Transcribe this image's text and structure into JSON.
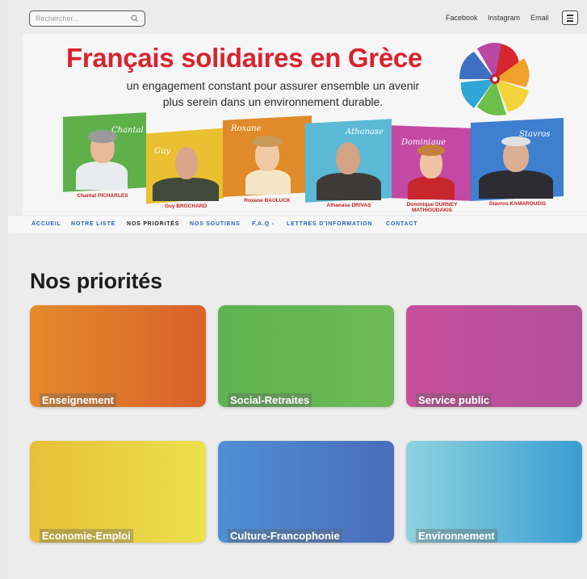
{
  "topbar": {
    "search_placeholder": "Rechercher...",
    "links": [
      "Facebook",
      "Instagram",
      "Email"
    ]
  },
  "banner": {
    "title": "Français solidaires en Grèce",
    "subtitle_line1": "un engagement constant pour assurer ensemble un avenir",
    "subtitle_line2": "plus serein dans un environnement durable.",
    "candidates": [
      {
        "signature": "Chantal",
        "caption": "Chantal PICHARLES",
        "color": "#5db04a"
      },
      {
        "signature": "Guy",
        "caption": "Guy BROCHARD",
        "color": "#e9c02f"
      },
      {
        "signature": "Roxane",
        "caption": "Roxane BAULUCK",
        "color": "#e08a2a"
      },
      {
        "signature": "Athanase",
        "caption": "Athanase DRIVAS",
        "color": "#5bb9d6"
      },
      {
        "signature": "Dominique",
        "caption_line1": "Dominique DURNEY",
        "caption_line2": "MATHIOUDAKIS",
        "color": "#c34aa4"
      },
      {
        "signature": "Stavros",
        "caption": "Stavros KAMAROUDIS",
        "color": "#3f7fd0"
      }
    ]
  },
  "nav": {
    "items": [
      "ACCUEIL",
      "NOTRE LISTE",
      "NOS PRIORITÉS",
      "NOS SOUTIENS",
      "F.A.Q -",
      "LETTRES D'INFORMATION",
      "CONTACT"
    ],
    "active": "NOS PRIORITÉS"
  },
  "main": {
    "heading": "Nos priorités",
    "tiles": [
      {
        "label": "Enseignement",
        "color_start": "#e48a2b",
        "color_end": "#d9612b"
      },
      {
        "label": "Social-Retraites",
        "color_start": "#5eb351",
        "color_end": "#6eb958"
      },
      {
        "label": "Service public",
        "color_start": "#c94f9d",
        "color_end": "#b25199"
      },
      {
        "label": "Economie-Emploi",
        "color_start": "#e7c039",
        "color_end": "#ece04c"
      },
      {
        "label": "Culture-Francophonie",
        "color_start": "#4f8fd4",
        "color_end": "#4a6db8"
      },
      {
        "label": "Environnement",
        "color_start": "#8fd2de",
        "color_end": "#3a9ed2"
      }
    ]
  }
}
